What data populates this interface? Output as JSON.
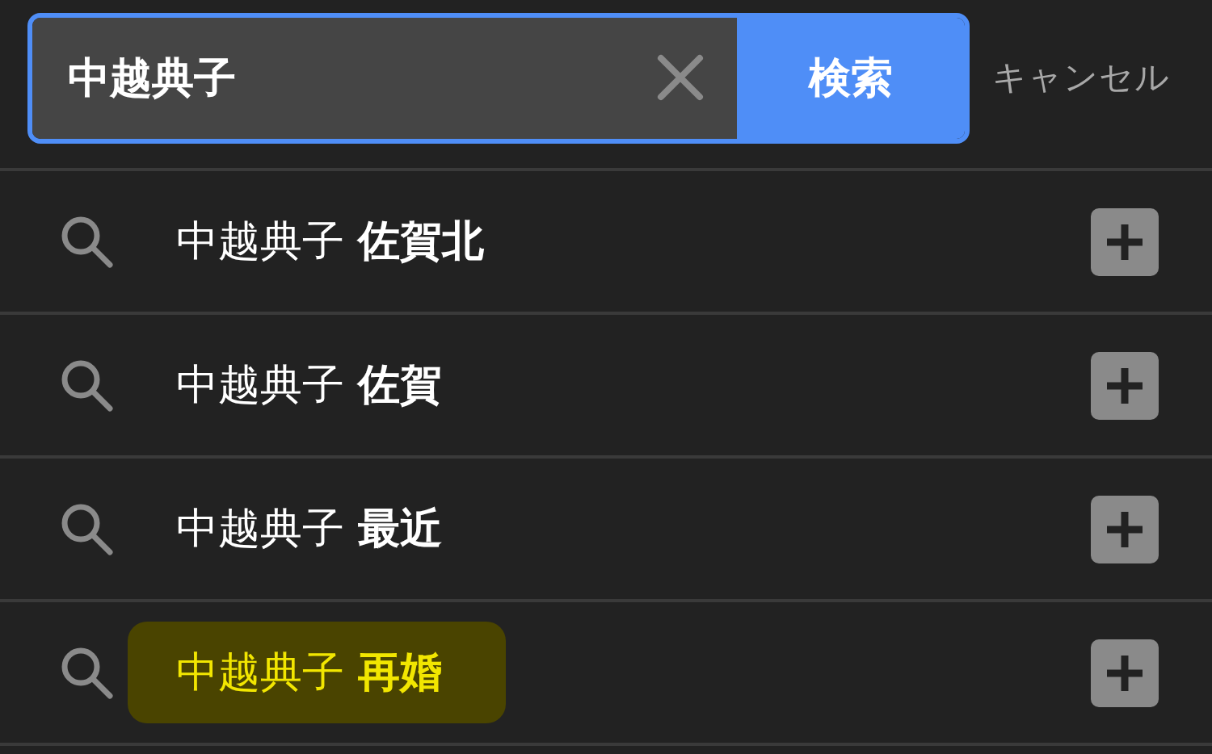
{
  "search": {
    "value": "中越典子",
    "button": "検索",
    "cancel": "キャンセル"
  },
  "suggestions": [
    {
      "text": "中越典子 **佐賀北**",
      "highlighted": false
    },
    {
      "text": "中越典子 **佐賀**",
      "highlighted": false
    },
    {
      "text": "中越典子 **最近**",
      "highlighted": false
    },
    {
      "text": "中越典子 **再婚**",
      "highlighted": true
    }
  ]
}
